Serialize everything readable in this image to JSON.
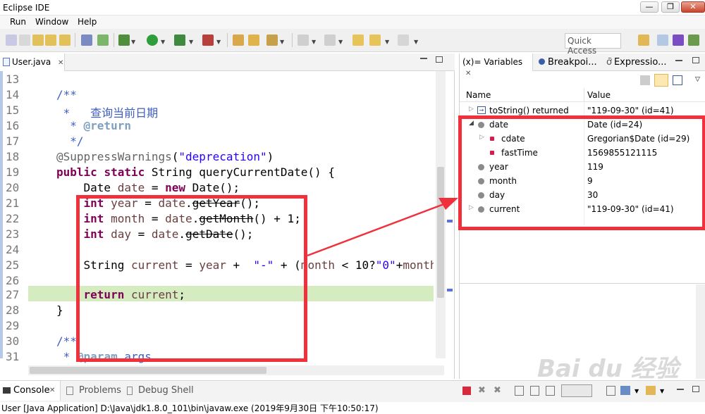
{
  "window": {
    "title": "Eclipse IDE",
    "min": "—",
    "max": "❐",
    "close": "✕"
  },
  "menu": [
    "Run",
    "Window",
    "Help"
  ],
  "toolbar": {
    "quick_access": "Quick Access"
  },
  "editor": {
    "tab_label": "User.java",
    "tab_close": "✕",
    "line_numbers": [
      "13",
      "14",
      "15",
      "16",
      "17",
      "18",
      "19",
      "20",
      "21",
      "22",
      "23",
      "24",
      "25",
      "26",
      "27",
      "28",
      "29",
      "30",
      "31"
    ]
  },
  "variables": {
    "tabs": [
      "(x)= Variables",
      "Breakpoi...",
      "Expressio..."
    ],
    "columns": [
      "Name",
      "Value"
    ],
    "rows": [
      {
        "name": "toString() returned",
        "value": "\"119-09-30\" (id=41)"
      },
      {
        "name": "date",
        "value": "Date  (id=24)"
      },
      {
        "name": "cdate",
        "value": "Gregorian$Date  (id=29)"
      },
      {
        "name": "fastTime",
        "value": "1569855121115"
      },
      {
        "name": "year",
        "value": "119"
      },
      {
        "name": "month",
        "value": "9"
      },
      {
        "name": "day",
        "value": "30"
      },
      {
        "name": "current",
        "value": "\"119-09-30\" (id=41)"
      }
    ]
  },
  "bottom": {
    "tabs": [
      "Console",
      "Problems",
      "Debug Shell"
    ],
    "console_line": "User [Java Application] D:\\Java\\jdk1.8.0_101\\bin\\javaw.exe (2019年9月30日 下午10:50:17)"
  },
  "watermark": "Bai du 经验",
  "colors": {
    "highlight_box": "#f0303a",
    "current_line": "#d4ecc0",
    "keyword": "#7f0055",
    "comment": "#3f5fbf",
    "string": "#2a00ff"
  }
}
